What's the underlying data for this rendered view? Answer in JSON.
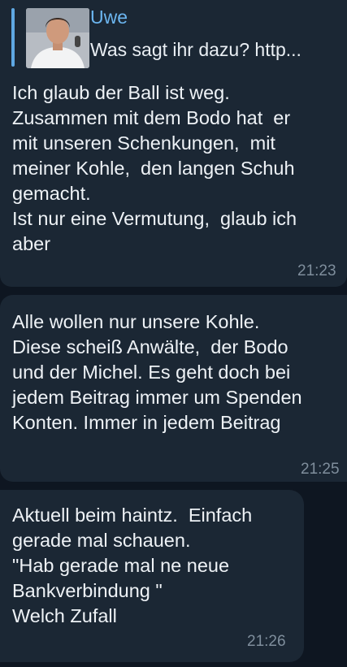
{
  "messages": [
    {
      "reply": {
        "author": "Uwe",
        "text": "Was sagt ihr dazu? http..."
      },
      "text": "Ich glaub der Ball ist weg.\nZusammen mit dem Bodo hat  er\nmit unseren Schenkungen,  mit\nmeiner Kohle,  den langen Schuh\ngemacht.\nIst nur eine Vermutung,  glaub ich\naber",
      "time": "21:23"
    },
    {
      "text": "Alle wollen nur unsere Kohle.\nDiese scheiß Anwälte,  der Bodo\nund der Michel. Es geht doch bei\njedem Beitrag immer um Spenden\nKonten. Immer in jedem Beitrag",
      "time": "21:25"
    },
    {
      "text": "Aktuell beim haintz.  Einfach\ngerade mal schauen.\n\"Hab gerade mal ne neue\nBankverbindung \"\nWelch Zufall",
      "time": "21:26"
    }
  ],
  "colors": {
    "background": "#0e1621",
    "bubble": "#1b2734",
    "reply_accent": "#5fa8e3",
    "timestamp": "#7f8e9c"
  }
}
